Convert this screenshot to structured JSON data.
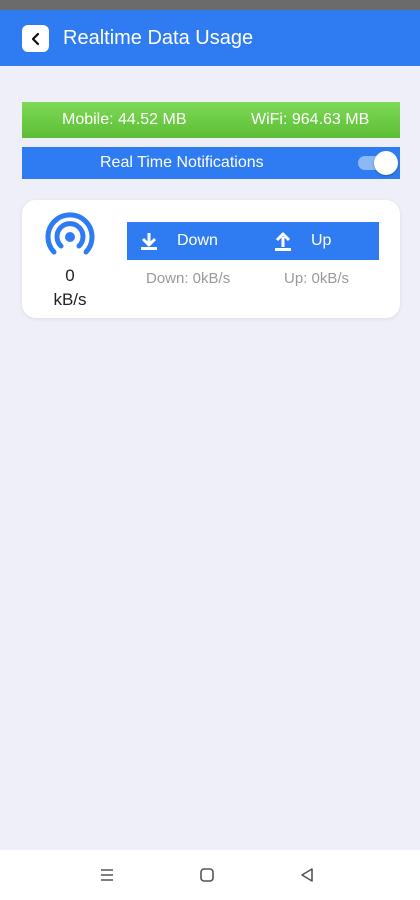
{
  "header": {
    "title": "Realtime Data Usage",
    "back_icon": "chevron-left-icon"
  },
  "usage": {
    "mobile": "Mobile: 44.52 MB",
    "wifi": "WiFi: 964.63 MB"
  },
  "notifications": {
    "label": "Real Time Notifications",
    "enabled": true
  },
  "speed": {
    "value": "0",
    "unit": "kB/s",
    "icon": "broadcast-signal-icon",
    "down_label": "Down",
    "up_label": "Up",
    "down_rate": "Down: 0kB/s",
    "up_rate": "Up: 0kB/s"
  },
  "colors": {
    "primary": "#2f7cf2",
    "usage_green": "#66c63e",
    "background": "#eeeff8"
  },
  "nav": {
    "recents_icon": "menu-lines-icon",
    "home_icon": "square-home-icon",
    "back_icon": "triangle-back-icon"
  }
}
